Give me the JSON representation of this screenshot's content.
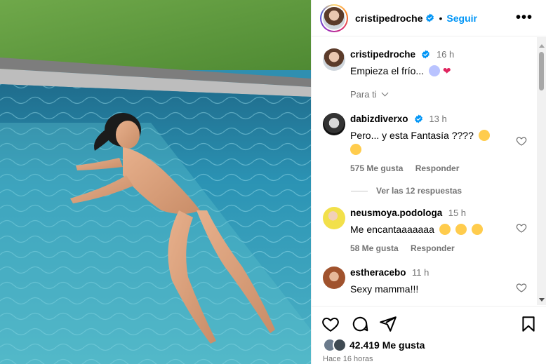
{
  "post": {
    "author": "cristipedroche",
    "separator": "•",
    "follow_label": "Seguir",
    "more_label": "•••",
    "caption": {
      "user": "cristipedroche",
      "time": "16 h",
      "text": "Empieza el frío..."
    },
    "sort_label": "Para ti"
  },
  "comments": [
    {
      "user": "dabizdiverxo",
      "time": "13 h",
      "text": "Pero... y esta Fantasía ????",
      "likes": "575 Me gusta",
      "reply": "Responder"
    },
    {
      "user": "neusmoya.podologa",
      "time": "15 h",
      "text": "Me encantaaaaaaa",
      "likes": "58 Me gusta",
      "reply": "Responder"
    },
    {
      "user": "estheracebo",
      "time": "11 h",
      "text": "Sexy mamma!!!",
      "likes": "",
      "reply": ""
    }
  ],
  "view_replies": "Ver las 12 respuestas",
  "likes_count": "42.419 Me gusta",
  "posted_ago": "Hace 16 horas",
  "icons": [
    "heart-icon",
    "comment-icon",
    "share-icon",
    "bookmark-icon",
    "verified-badge-icon",
    "more-options-icon"
  ],
  "colors": {
    "accent": "#0095f6",
    "muted": "#737373",
    "verified": "#0095f6",
    "heart": "#e0245e"
  }
}
